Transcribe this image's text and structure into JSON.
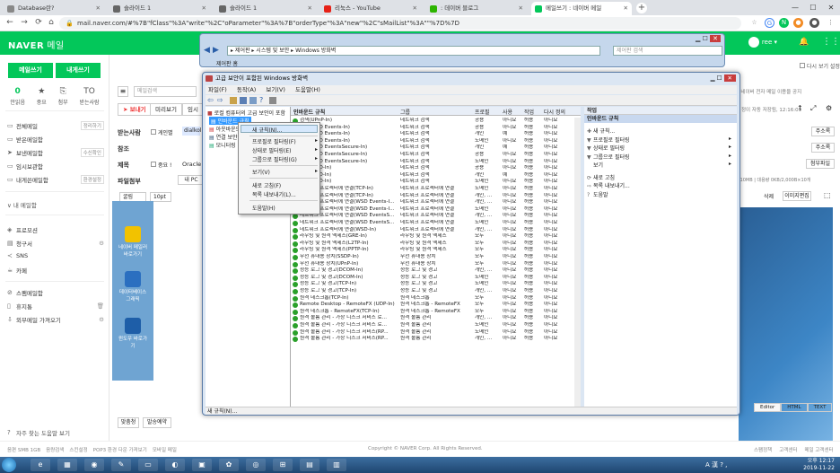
{
  "browser": {
    "tabs": [
      {
        "label": "Database란?",
        "color": "#888"
      },
      {
        "label": "슬라이드 1",
        "color": "#666"
      },
      {
        "label": "슬라이드 1",
        "color": "#666"
      },
      {
        "label": "리눅스 - YouTube",
        "color": "#e62117"
      },
      {
        "label": ": 데이버 블로그",
        "color": "#2db400"
      },
      {
        "label": "메일쓰기 : 네이버 메일",
        "color": "#03c75a"
      }
    ],
    "url": "mail.naver.com/#%7B\"fClass\"%3A\"write\"%2C\"oParameter\"%3A%7B\"orderType\"%3A\"new\"%2C\"sMailList\"%3A\"\"%7D%7D"
  },
  "naver": {
    "logo": "NAVER",
    "logo_sub": "메일",
    "user": "ree ▾",
    "btn_write": "메일쓰기",
    "btn_self": "내게쓰기",
    "quick": [
      {
        "top": "0",
        "label": "안읽음"
      },
      {
        "top": "★",
        "label": "중요"
      },
      {
        "top": "⎘",
        "label": "첨부"
      },
      {
        "top": "TO",
        "label": "받는사람"
      }
    ],
    "mailboxes": [
      {
        "label": "전체메일",
        "right": "정리하기"
      },
      {
        "label": "받은메일함",
        "right": ""
      },
      {
        "label": "보낸메일함",
        "right": "수신확인"
      },
      {
        "label": "임시보관함",
        "right": ""
      },
      {
        "label": "내게쓴메일함",
        "right": "환경설정"
      }
    ],
    "my_folder": "∨ 내 메일함",
    "extra": [
      {
        "label": "프로모션",
        "right": ""
      },
      {
        "label": "청구서",
        "right": "⚙"
      },
      {
        "label": "SNS",
        "right": ""
      },
      {
        "label": "카페",
        "right": ""
      },
      {
        "label": "스팸메일함",
        "right": ""
      },
      {
        "label": "휴지통",
        "right": "🗑"
      },
      {
        "label": "외부메일 가져오기",
        "right": "⚙"
      }
    ],
    "help": "자주 찾는 도움말 보기",
    "compose": {
      "send": "보내기",
      "preview": "미리보기",
      "temp": "임시",
      "to_label": "받는사람",
      "to_check": "게인별",
      "to_value": "dialkol",
      "cc_label": "참조",
      "subject_label": "제목",
      "subject_check": "중요 !",
      "subject_value": "Oracle",
      "attach_label": "파일첨부",
      "attach_value": "내 PC",
      "font": "굴림",
      "size": "10pt",
      "address_book": "주소록",
      "image_note": "[개인]네이버 전자 메일 이용을 공지",
      "auto_save": "정이 자동 저장됨, 12:16:09",
      "size_info": "0KB/10MB | 대용량 0KB/2,000B×10개",
      "attach_btn": "첨부파일",
      "delete_btn": "삭제",
      "image_edit": "이미지편집",
      "editor_tabs": [
        "Editor",
        "HTML",
        "TEXT"
      ],
      "bottom_btns": [
        "맞춤청",
        "발송예약"
      ],
      "send_split": "다시 보기 설정"
    },
    "footer_links": [
      "음편 SMB 1GB",
      "음량검색",
      "스킨설정",
      "POP3 환경 다운 가져보기",
      "모바일 메일"
    ],
    "copyright": "Copyright © NAVER Corp. All Rights Reserved.",
    "footer_right": [
      "스팸정책",
      "고객센터",
      "메일 고객센터"
    ]
  },
  "desktop_icons": [
    {
      "label": "네이버 메일러 바로가기",
      "color": "#f2c200"
    },
    {
      "label": "데이터베이스 그래픽",
      "color": "#2b6fc0"
    },
    {
      "label": "윈도우 바로가기",
      "color": "#1e5ea8"
    }
  ],
  "controlpanel": {
    "breadcrumb": "▸ 제어판 ▸ 시스템 및 보안 ▸ Windows 방화벽",
    "search_placeholder": "제어판 검색",
    "side_label": "제어판 홈"
  },
  "firewall": {
    "title": "고급 보안이 포함된 Windows 방화벽",
    "menu": [
      "파일(F)",
      "동작(A)",
      "보기(V)",
      "도움말(H)"
    ],
    "tree": [
      "로컬 컴퓨터의 고급 보안이 포함",
      "인바운드 규칙",
      "아웃바운드",
      "연결 보안",
      "모니터링"
    ],
    "list_title": "인바운드 규칙",
    "columns": [
      "이름",
      "그룹",
      "프로필",
      "사용",
      "작업",
      "다시 정의"
    ],
    "rows": [
      [
        "검색(UPnP-In)",
        "네트워크 검색",
        "공용",
        "아니요",
        "허용",
        "아니요"
      ],
      [
        "검색(WSD Events-In)",
        "네트워크 검색",
        "공용",
        "아니요",
        "허용",
        "아니요"
      ],
      [
        "검색(WSD Events-In)",
        "네트워크 검색",
        "개인",
        "예",
        "허용",
        "아니요"
      ],
      [
        "검색(WSD Events-In)",
        "네트워크 검색",
        "도메인",
        "아니요",
        "허용",
        "아니요"
      ],
      [
        "검색(WSD EventsSecure-In)",
        "네트워크 검색",
        "개인",
        "예",
        "허용",
        "아니요"
      ],
      [
        "검색(WSD EventsSecure-In)",
        "네트워크 검색",
        "공용",
        "아니요",
        "허용",
        "아니요"
      ],
      [
        "검색(WSD EventsSecure-In)",
        "네트워크 검색",
        "도메인",
        "아니요",
        "허용",
        "아니요"
      ],
      [
        "검색(WSD-In)",
        "네트워크 검색",
        "공용",
        "아니요",
        "허용",
        "아니요"
      ],
      [
        "검색(WSD-In)",
        "네트워크 검색",
        "개인",
        "예",
        "허용",
        "아니요"
      ],
      [
        "검색(WSD-In)",
        "네트워크 검색",
        "도메인",
        "아니요",
        "허용",
        "아니요"
      ],
      [
        "네트워크 프로젝터에 연결(TCP-In)",
        "네트워크 프로젝터에 연결",
        "도메인",
        "아니요",
        "허용",
        "아니요"
      ],
      [
        "네트워크 프로젝터에 연결(TCP-In)",
        "네트워크 프로젝터에 연결",
        "개인, ...",
        "아니요",
        "허용",
        "아니요"
      ],
      [
        "네트워크 프로젝터에 연결(WSD Events-I...",
        "네트워크 프로젝터에 연결",
        "개인, ...",
        "아니요",
        "허용",
        "아니요"
      ],
      [
        "네트워크 프로젝터에 연결(WSD Events-I...",
        "네트워크 프로젝터에 연결",
        "도메인",
        "아니요",
        "허용",
        "아니요"
      ],
      [
        "네트워크 프로젝터에 연결(WSD EventsS...",
        "네트워크 프로젝터에 연결",
        "개인, ...",
        "아니요",
        "허용",
        "아니요"
      ],
      [
        "네트워크 프로젝터에 연결(WSD EventsS...",
        "네트워크 프로젝터에 연결",
        "도메인",
        "아니요",
        "허용",
        "아니요"
      ],
      [
        "네트워크 프로젝터에 연결(WSD-In)",
        "네트워크 프로젝터에 연결",
        "개인, ...",
        "아니요",
        "허용",
        "아니요"
      ],
      [
        "라우팅 및 원격 액세스(GRE-In)",
        "라우팅 및 원격 액세스",
        "모두",
        "아니요",
        "허용",
        "아니요"
      ],
      [
        "라우팅 및 원격 액세스(L2TP-In)",
        "라우팅 및 원격 액세스",
        "모두",
        "아니요",
        "허용",
        "아니요"
      ],
      [
        "라우팅 및 원격 액세스(PPTP-In)",
        "라우팅 및 원격 액세스",
        "모두",
        "아니요",
        "허용",
        "아니요"
      ],
      [
        "무선 휴대용 장치(SSDP-In)",
        "무선 휴대용 장치",
        "모두",
        "아니요",
        "허용",
        "아니요"
      ],
      [
        "무선 휴대용 장치(UPnP-In)",
        "무선 휴대용 장치",
        "모두",
        "아니요",
        "허용",
        "아니요"
      ],
      [
        "성능 로그 및 경고(DCOM-In)",
        "성능 로그 및 경고",
        "개인, ...",
        "아니요",
        "허용",
        "아니요"
      ],
      [
        "성능 로그 및 경고(DCOM-In)",
        "성능 로그 및 경고",
        "도메인",
        "아니요",
        "허용",
        "아니요"
      ],
      [
        "성능 로그 및 경고(TCP-In)",
        "성능 로그 및 경고",
        "도메인",
        "아니요",
        "허용",
        "아니요"
      ],
      [
        "성능 로그 및 경고(TCP-In)",
        "성능 로그 및 경고",
        "개인, ...",
        "아니요",
        "허용",
        "아니요"
      ],
      [
        "원격 데스크톱(TCP-In)",
        "원격 데스크톱",
        "모두",
        "아니요",
        "허용",
        "아니요"
      ],
      [
        "Remote Desktop - RemoteFX (UDP-In)",
        "원격 데스크톱 - RemoteFX",
        "모두",
        "아니요",
        "허용",
        "아니요"
      ],
      [
        "원격 데스크톱 - RemoteFX(TCP-In)",
        "원격 데스크톱 - RemoteFX",
        "모두",
        "아니요",
        "허용",
        "아니요"
      ],
      [
        "원격 볼륨 관리 - 가상 디스크 서비스 로...",
        "원격 볼륨 관리",
        "개인, ...",
        "아니요",
        "허용",
        "아니요"
      ],
      [
        "원격 볼륨 관리 - 가상 디스크 서비스 로...",
        "원격 볼륨 관리",
        "도메인",
        "아니요",
        "허용",
        "아니요"
      ],
      [
        "원격 볼륨 관리 - 가상 디스크 서비스(RP...",
        "원격 볼륨 관리",
        "도메인",
        "아니요",
        "허용",
        "아니요"
      ],
      [
        "원격 볼륨 관리 - 가상 디스크 서비스(RP...",
        "원격 볼륨 관리",
        "개인, ...",
        "아니요",
        "허용",
        "아니요"
      ]
    ],
    "actions_header": "작업",
    "actions_sub": "인바운드 규칙",
    "actions": [
      {
        "icon": "✚",
        "label": "새 규칙..."
      },
      {
        "icon": "▼",
        "label": "프로필로 필터링",
        "arrow": true
      },
      {
        "icon": "▼",
        "label": "상태로 필터링",
        "arrow": true
      },
      {
        "icon": "▼",
        "label": "그룹으로 필터링",
        "arrow": true
      },
      {
        "icon": "",
        "label": "보기",
        "arrow": true
      },
      {
        "icon": "⟳",
        "label": "새로 고침"
      },
      {
        "icon": "⇨",
        "label": "목록 내보내기..."
      },
      {
        "icon": "?",
        "label": "도움말"
      }
    ],
    "status": "새 규칙(N)..."
  },
  "context_menu": [
    {
      "label": "새 규칙(N)...",
      "arrow": false
    },
    {
      "label": "프로필로 필터링(F)",
      "arrow": true
    },
    {
      "label": "상태로 필터링(E)",
      "arrow": true
    },
    {
      "label": "그룹으로 필터링(G)",
      "arrow": true
    },
    {
      "label": "보기(V)",
      "arrow": true
    },
    {
      "label": "새로 고침(F)",
      "arrow": false
    },
    {
      "label": "목록 내보내기(L)...",
      "arrow": false
    },
    {
      "label": "도움말(H)",
      "arrow": false
    }
  ],
  "clock": {
    "time": "오후 12:17",
    "date": "2019-11-22"
  },
  "tray": "A 漢 ? ,"
}
